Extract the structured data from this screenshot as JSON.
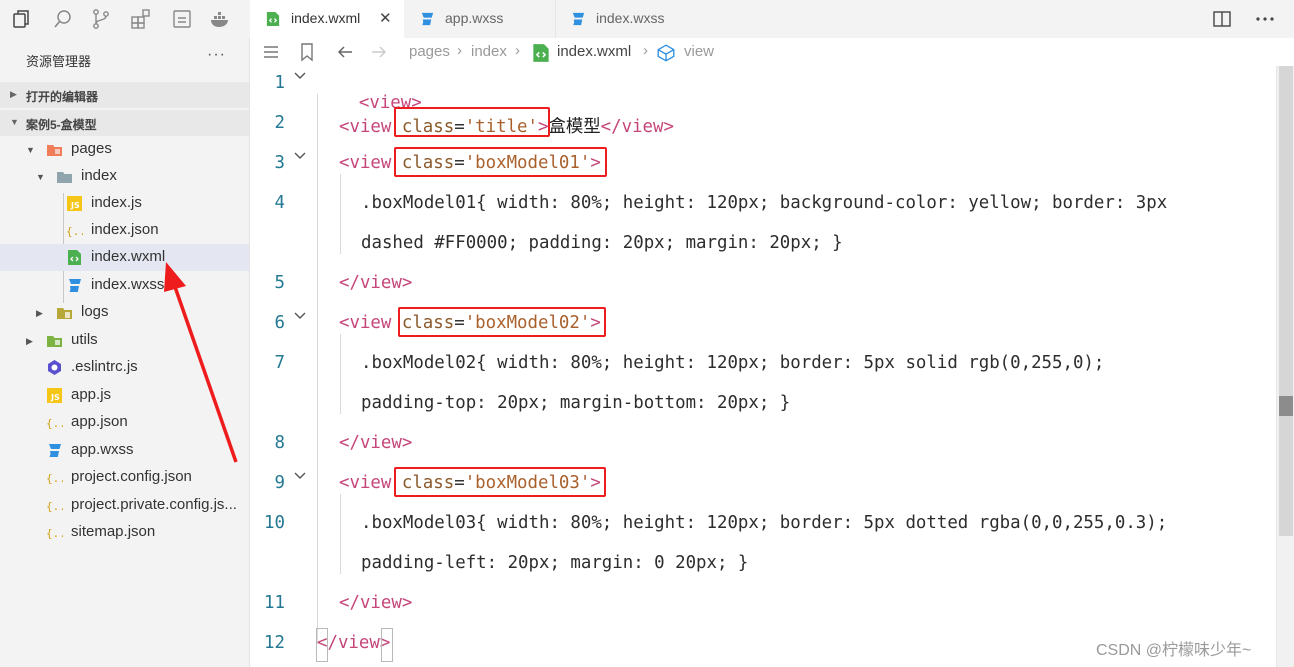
{
  "activity_bar": {
    "icons": [
      "files-icon",
      "search-icon",
      "source-control-icon",
      "extensions-icon",
      "minimize-icon",
      "docker-icon"
    ]
  },
  "sidebar": {
    "title": "资源管理器",
    "more": "···",
    "open_editors": "打开的编辑器",
    "project": "案例5-盒模型",
    "tree": [
      {
        "name": "pages",
        "icon": "folder-pages-icon"
      },
      {
        "name": "index",
        "icon": "folder-icon"
      },
      {
        "name": "index.js",
        "icon": "js-file-icon"
      },
      {
        "name": "index.json",
        "icon": "json-file-icon"
      },
      {
        "name": "index.wxml",
        "icon": "wxml-file-icon",
        "selected": true
      },
      {
        "name": "index.wxss",
        "icon": "wxss-file-icon"
      },
      {
        "name": "logs",
        "icon": "folder-logs-icon"
      },
      {
        "name": "utils",
        "icon": "folder-utils-icon"
      },
      {
        "name": ".eslintrc.js",
        "icon": "eslint-file-icon"
      },
      {
        "name": "app.js",
        "icon": "js-file-icon"
      },
      {
        "name": "app.json",
        "icon": "json-file-icon"
      },
      {
        "name": "app.wxss",
        "icon": "wxss-file-icon"
      },
      {
        "name": "project.config.json",
        "icon": "json-file-icon"
      },
      {
        "name": "project.private.config.js...",
        "icon": "json-file-icon"
      },
      {
        "name": "sitemap.json",
        "icon": "json-file-icon"
      }
    ]
  },
  "tabs": [
    {
      "label": "index.wxml",
      "icon": "wxml-file-icon",
      "active": true,
      "close": "✕"
    },
    {
      "label": "app.wxss",
      "icon": "wxss-file-icon",
      "active": false
    },
    {
      "label": "index.wxss",
      "icon": "wxss-file-icon",
      "active": false
    }
  ],
  "breadcrumb": {
    "items": [
      "pages",
      "index",
      "index.wxml",
      "view"
    ],
    "separator": "›"
  },
  "editor": {
    "line_numbers": [
      "1",
      "2",
      "3",
      "4",
      "5",
      "6",
      "7",
      "8",
      "9",
      "10",
      "11",
      "12"
    ],
    "lines": {
      "l1_tag": "<view>",
      "l2_open": "<view",
      "l2_attr": "class",
      "l2_eq": "=",
      "l2_str": "'title'",
      "l2_close": ">",
      "l2_text": "盒模型",
      "l2_end": "</view>",
      "l3_open": "<view",
      "l3_attr": "class",
      "l3_eq": "=",
      "l3_str": "'boxModel01'",
      "l3_close": ">",
      "l4_a": ".boxModel01{ width: 80%; height: 120px; background-color: yellow; border: 3px",
      "l4_b": "dashed #FF0000; padding: 20px; margin: 20px; }",
      "l5": "</view>",
      "l6_open": "<view",
      "l6_attr": "class",
      "l6_eq": "=",
      "l6_str": "'boxModel02'",
      "l6_close": ">",
      "l7_a": ".boxModel02{ width: 80%; height: 120px; border: 5px solid rgb(0,255,0);",
      "l7_b": "padding-top: 20px; margin-bottom: 20px; }",
      "l8": "</view>",
      "l9_open": "<view",
      "l9_attr": "class",
      "l9_eq": "=",
      "l9_str": "'boxModel03'",
      "l9_close": ">",
      "l10_a": ".boxModel03{ width: 80%; height: 120px; border: 5px dotted rgba(0,0,255,0.3);",
      "l10_b": "padding-left: 20px; margin: 0 20px; }",
      "l11": "</view>",
      "l12_lt": "<",
      "l12_mid": "/view",
      "l12_gt": ">"
    }
  },
  "watermark": "CSDN @柠檬味少年~",
  "colors": {
    "tag": "#c5467a",
    "attribute": "#8b5a2b",
    "string": "#a9602c",
    "line_number": "#237893",
    "annotation_red": "#ee1c1c"
  }
}
